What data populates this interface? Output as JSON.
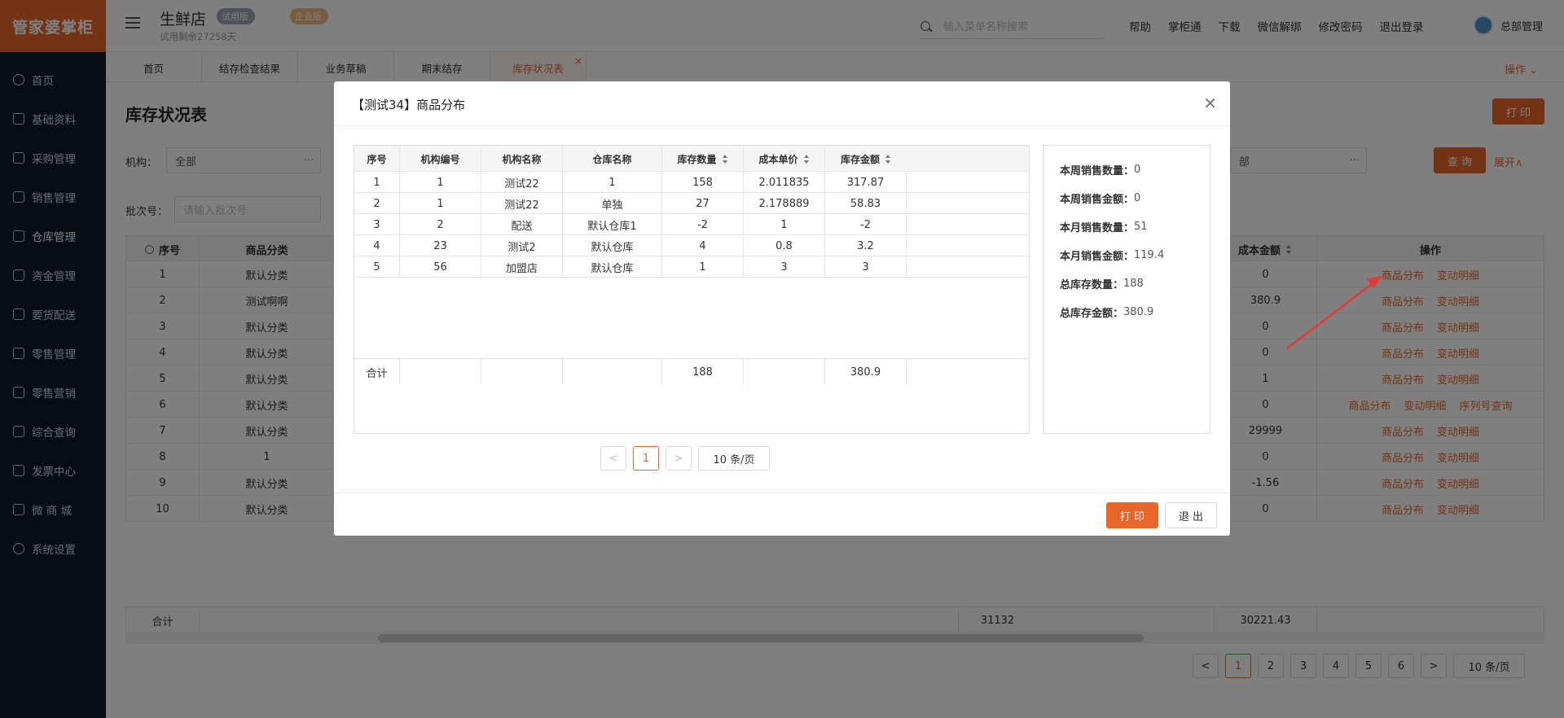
{
  "app": {
    "logo": "管家婆掌柜",
    "shop_name": "生鲜店",
    "trial_tag": "试用版",
    "edition_tag": "企业版",
    "trial_remaining": "试用剩余27258天"
  },
  "sidebar": {
    "items": [
      {
        "label": "首页",
        "icon": "globe-icon"
      },
      {
        "label": "基础资料",
        "icon": "home-icon"
      },
      {
        "label": "采购管理",
        "icon": "cart-icon"
      },
      {
        "label": "销售管理",
        "icon": "sales-icon"
      },
      {
        "label": "仓库管理",
        "icon": "warehouse-icon"
      },
      {
        "label": "资金管理",
        "icon": "money-icon"
      },
      {
        "label": "要货配送",
        "icon": "delivery-icon"
      },
      {
        "label": "零售管理",
        "icon": "retail-icon"
      },
      {
        "label": "零售营销",
        "icon": "gift-icon"
      },
      {
        "label": "综合查询",
        "icon": "chart-icon"
      },
      {
        "label": "发票中心",
        "icon": "invoice-icon"
      },
      {
        "label": "微 商 城",
        "icon": "shop-icon"
      },
      {
        "label": "系统设置",
        "icon": "gear-icon"
      }
    ]
  },
  "header": {
    "search_placeholder": "输入菜单名称搜索",
    "links": [
      "帮助",
      "掌柜通",
      "下载",
      "微信解绑",
      "修改密码",
      "退出登录"
    ],
    "user": "总部管理"
  },
  "tabs": {
    "items": [
      "首页",
      "结存检查结果",
      "业务草稿",
      "期末结存",
      "库存状况表"
    ],
    "close": "×",
    "ops": "操作 ⌄"
  },
  "page": {
    "title": "库存状况表",
    "print": "打 印",
    "org_label": "机构：",
    "org_value": "全部",
    "batch_label": "批次号：",
    "batch_placeholder": "请输入批次号",
    "right_filter_value": "部",
    "query": "查 询",
    "expand": "展开∧",
    "table": {
      "headers": [
        "序号",
        "商品分类",
        "成本金额",
        "操作"
      ],
      "rows": [
        {
          "no": "1",
          "cat": "默认分类",
          "amount": "0",
          "ops": [
            "商品分布",
            "变动明细"
          ]
        },
        {
          "no": "2",
          "cat": "测试啊啊",
          "amount": "380.9",
          "ops": [
            "商品分布",
            "变动明细"
          ]
        },
        {
          "no": "3",
          "cat": "默认分类",
          "amount": "0",
          "ops": [
            "商品分布",
            "变动明细"
          ]
        },
        {
          "no": "4",
          "cat": "默认分类",
          "amount": "0",
          "ops": [
            "商品分布",
            "变动明细"
          ]
        },
        {
          "no": "5",
          "cat": "默认分类",
          "amount": "1",
          "ops": [
            "商品分布",
            "变动明细"
          ]
        },
        {
          "no": "6",
          "cat": "默认分类",
          "amount": "0",
          "ops": [
            "商品分布",
            "变动明细",
            "序列号查询"
          ]
        },
        {
          "no": "7",
          "cat": "默认分类",
          "amount": "29999",
          "ops": [
            "商品分布",
            "变动明细"
          ]
        },
        {
          "no": "8",
          "cat": "1",
          "amount": "0",
          "ops": [
            "商品分布",
            "变动明细"
          ]
        },
        {
          "no": "9",
          "cat": "默认分类",
          "amount": "-1.56",
          "ops": [
            "商品分布",
            "变动明细"
          ]
        },
        {
          "no": "10",
          "cat": "默认分类",
          "amount": "0",
          "ops": [
            "商品分布",
            "变动明细"
          ]
        }
      ],
      "total_label": "合计",
      "total_qty": "31132",
      "total_amount": "30221.43"
    },
    "pager": {
      "prev": "<",
      "pages": [
        "1",
        "2",
        "3",
        "4",
        "5",
        "6"
      ],
      "next": ">",
      "size": "10 条/页"
    }
  },
  "modal": {
    "title": "【测试34】商品分布",
    "close": "×",
    "headers": [
      "序号",
      "机构编号",
      "机构名称",
      "仓库名称",
      "库存数量",
      "成本单价",
      "库存金额"
    ],
    "rows": [
      [
        "1",
        "1",
        "测试22",
        "1",
        "158",
        "2.011835",
        "317.87"
      ],
      [
        "2",
        "1",
        "测试22",
        "单独",
        "27",
        "2.178889",
        "58.83"
      ],
      [
        "3",
        "2",
        "配送",
        "默认仓库1",
        "-2",
        "1",
        "-2"
      ],
      [
        "4",
        "23",
        "测试2",
        "默认仓库",
        "4",
        "0.8",
        "3.2"
      ],
      [
        "5",
        "56",
        "加盟店",
        "默认仓库",
        "1",
        "3",
        "3"
      ]
    ],
    "total": {
      "label": "合计",
      "qty": "188",
      "amount": "380.9"
    },
    "stats": [
      {
        "k": "本周销售数量：",
        "v": "0"
      },
      {
        "k": "本周销售金额：",
        "v": "0"
      },
      {
        "k": "本月销售数量：",
        "v": "51"
      },
      {
        "k": "本月销售金额：",
        "v": "119.4"
      },
      {
        "k": "总库存数量：",
        "v": "188"
      },
      {
        "k": "总库存金额：",
        "v": "380.9"
      }
    ],
    "pager": {
      "prev": "<",
      "page": "1",
      "next": ">",
      "size": "10 条/页"
    },
    "print": "打 印",
    "exit": "退 出"
  },
  "colors": {
    "accent": "#e8662a",
    "sidebar": "#0f1a2b",
    "arrow": "#e53935"
  }
}
